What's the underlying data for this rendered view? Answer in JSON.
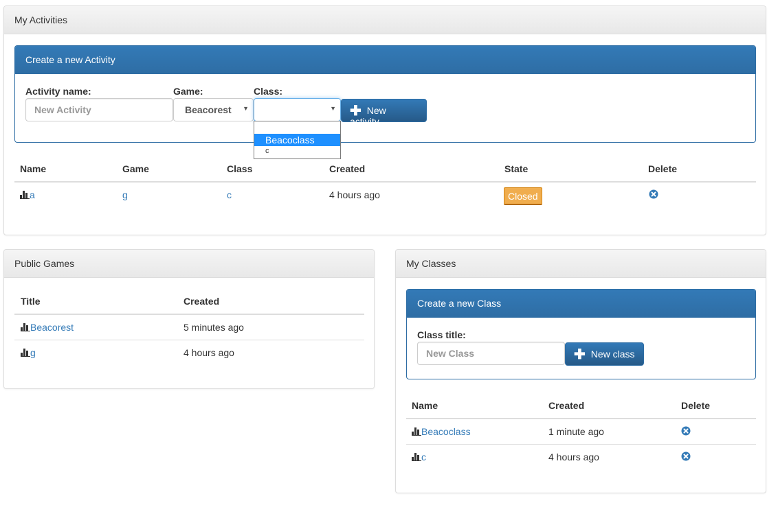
{
  "activities_panel": {
    "title": "My Activities",
    "create": {
      "heading": "Create a new Activity",
      "name_label": "Activity name:",
      "name_placeholder": "New Activity",
      "game_label": "Game:",
      "game_selected": "Beacorest",
      "class_label": "Class:",
      "class_selected": "",
      "class_options": [
        "Beacoclass",
        "c"
      ],
      "button_label": "New activity"
    },
    "table": {
      "headers": [
        "Name",
        "Game",
        "Class",
        "Created",
        "State",
        "Delete"
      ],
      "rows": [
        {
          "name": "a",
          "game": "g",
          "class": "c",
          "created": "4 hours ago",
          "state": "Closed"
        }
      ]
    }
  },
  "games_panel": {
    "title": "Public Games",
    "table": {
      "headers": [
        "Title",
        "Created"
      ],
      "rows": [
        {
          "title": "Beacorest",
          "created": "5 minutes ago"
        },
        {
          "title": "g",
          "created": "4 hours ago"
        }
      ]
    }
  },
  "classes_panel": {
    "title": "My Classes",
    "create": {
      "heading": "Create a new Class",
      "title_label": "Class title:",
      "title_placeholder": "New Class",
      "button_label": "New class"
    },
    "table": {
      "headers": [
        "Name",
        "Created",
        "Delete"
      ],
      "rows": [
        {
          "name": "Beacoclass",
          "created": "1 minute ago"
        },
        {
          "name": "c",
          "created": "4 hours ago"
        }
      ]
    }
  },
  "colors": {
    "primary": "#337ab7",
    "warning": "#f0ad4e",
    "dropdown_highlight": "#1e90ff"
  }
}
